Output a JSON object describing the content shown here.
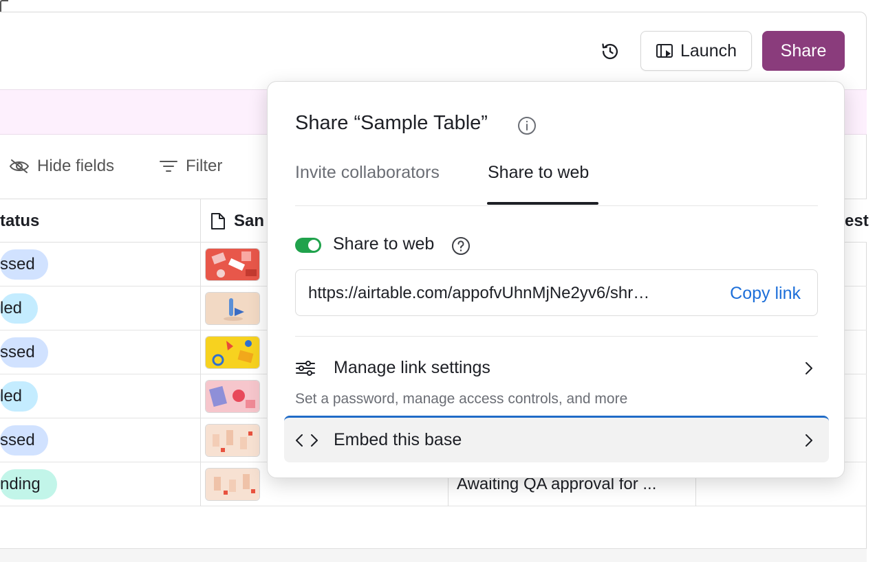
{
  "header": {
    "launch_label": "Launch",
    "share_label": "Share",
    "history_icon": "history-icon",
    "launch_icon": "launch-icon"
  },
  "toolbar": {
    "hide_fields_label": "Hide fields",
    "filter_label": "Filter"
  },
  "grid": {
    "columns": [
      {
        "label": "tatus"
      },
      {
        "label": "San"
      },
      {
        "label": "est"
      }
    ],
    "rows": [
      {
        "status": "ssed",
        "status_color": "blue",
        "note": ""
      },
      {
        "status": "led",
        "status_color": "cyan",
        "note": ""
      },
      {
        "status": "ssed",
        "status_color": "blue",
        "note": ""
      },
      {
        "status": "led",
        "status_color": "cyan",
        "note": ""
      },
      {
        "status": "ssed",
        "status_color": "blue",
        "note": ""
      },
      {
        "status": "nding",
        "status_color": "teal",
        "note": "Awaiting QA approval for ..."
      }
    ]
  },
  "popover": {
    "title": "Share “Sample Table”",
    "tabs": [
      {
        "label": "Invite collaborators",
        "active": false
      },
      {
        "label": "Share to web",
        "active": true
      }
    ],
    "share_to_web": {
      "label": "Share to web",
      "enabled": true,
      "url": "https://airtable.com/appofvUhnMjNe2yv6/shr…",
      "copy_label": "Copy link"
    },
    "manage": {
      "label": "Manage link settings",
      "description": "Set a password, manage access controls, and more"
    },
    "embed": {
      "label": "Embed this base"
    }
  },
  "colors": {
    "share_button": "#8a3c7c",
    "toggle_on": "#20a24c",
    "copy_link": "#1d6fd9",
    "banner": "#fdf0fd",
    "focus_outline": "#1f6bc7"
  }
}
